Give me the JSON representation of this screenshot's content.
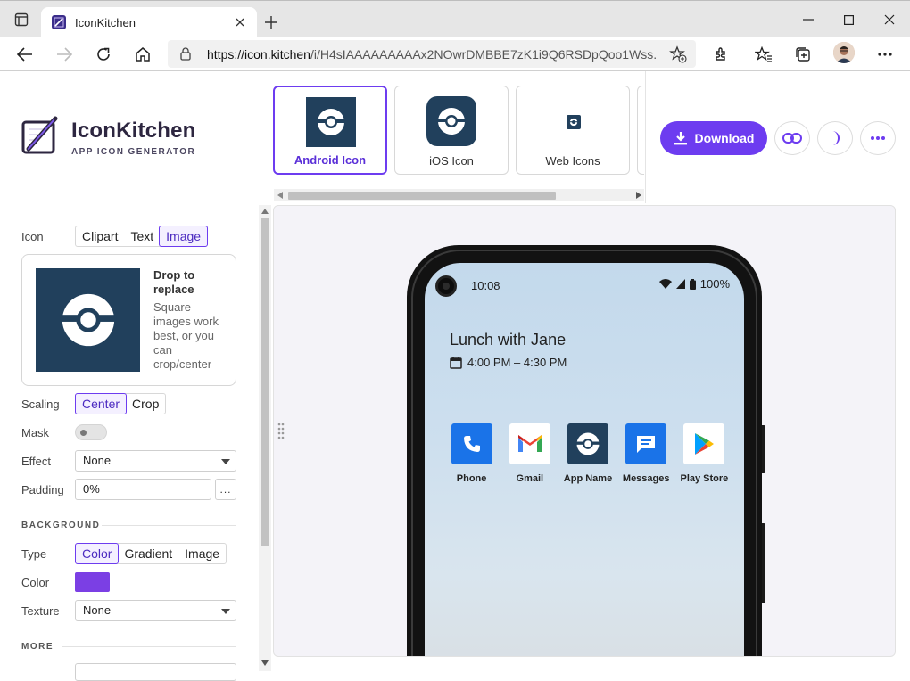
{
  "browser": {
    "tab_title": "IconKitchen",
    "url_host": "https://icon.kitchen",
    "url_path": "/i/H4sIAAAAAAAAAx2NOwrDMBBE7zK1i9Q6RSDpQoo1Wss..."
  },
  "brand": {
    "name": "IconKitchen",
    "subtitle": "APP ICON GENERATOR"
  },
  "targets": [
    {
      "label": "Android Icon",
      "active": true
    },
    {
      "label": "iOS Icon",
      "active": false
    },
    {
      "label": "Web Icons",
      "active": false
    }
  ],
  "toolbar": {
    "download_label": "Download"
  },
  "icon": {
    "label": "Icon",
    "options": [
      "Clipart",
      "Text",
      "Image"
    ],
    "selected": "Image",
    "drop_title": "Drop to replace",
    "drop_text": "Square images work best, or you can crop/center"
  },
  "scaling": {
    "label": "Scaling",
    "options": [
      "Center",
      "Crop"
    ],
    "selected": "Center"
  },
  "mask": {
    "label": "Mask",
    "on": false
  },
  "effect": {
    "label": "Effect",
    "value": "None"
  },
  "padding": {
    "label": "Padding",
    "value": "0%",
    "more": "..."
  },
  "background": {
    "section": "BACKGROUND",
    "type_label": "Type",
    "type_options": [
      "Color",
      "Gradient",
      "Image"
    ],
    "type_selected": "Color",
    "color_label": "Color",
    "color_value": "#7b3fe4",
    "texture_label": "Texture",
    "texture_value": "None"
  },
  "more": {
    "section": "MORE"
  },
  "phone": {
    "time": "10:08",
    "battery": "100%",
    "event_title": "Lunch with Jane",
    "event_time": "4:00 PM – 4:30 PM",
    "apps": [
      {
        "name": "Phone",
        "icon": "phone-icon"
      },
      {
        "name": "Gmail",
        "icon": "gmail-icon"
      },
      {
        "name": "App Name",
        "icon": "app-icon"
      },
      {
        "name": "Messages",
        "icon": "messages-icon"
      },
      {
        "name": "Play Store",
        "icon": "play-store-icon"
      }
    ]
  },
  "colors": {
    "accent": "#6d3cf0",
    "icon_bg": "#21405c"
  }
}
